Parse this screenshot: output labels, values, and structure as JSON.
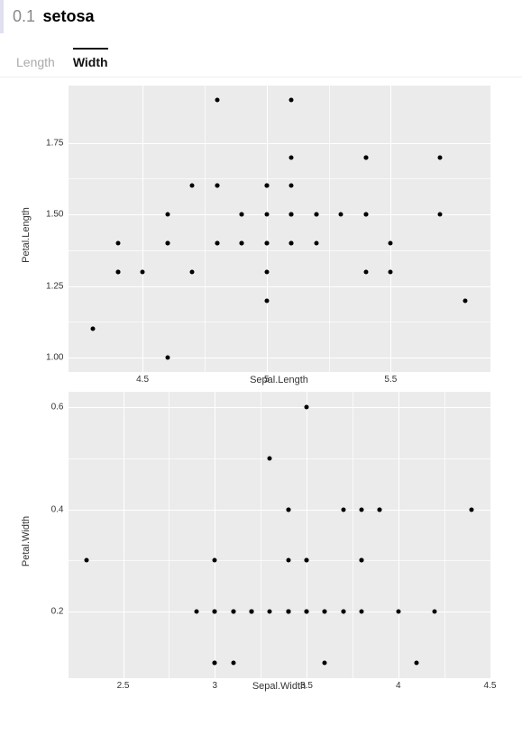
{
  "header": {
    "num": "0.1",
    "title": "setosa"
  },
  "tabs": [
    {
      "id": "length",
      "label": "Length",
      "active": false
    },
    {
      "id": "width",
      "label": "Width",
      "active": true
    }
  ],
  "chart_data": [
    {
      "type": "scatter",
      "xlabel": "Sepal.Length",
      "ylabel": "Petal.Length",
      "xlim": [
        4.2,
        5.9
      ],
      "ylim": [
        0.95,
        1.95
      ],
      "xticks": [
        4.5,
        5.0,
        5.5
      ],
      "yticks": [
        1.0,
        1.25,
        1.5,
        1.75
      ],
      "points": [
        {
          "x": 5.1,
          "y": 1.4
        },
        {
          "x": 4.9,
          "y": 1.4
        },
        {
          "x": 4.7,
          "y": 1.3
        },
        {
          "x": 4.6,
          "y": 1.5
        },
        {
          "x": 5.0,
          "y": 1.4
        },
        {
          "x": 5.4,
          "y": 1.7
        },
        {
          "x": 4.6,
          "y": 1.4
        },
        {
          "x": 5.0,
          "y": 1.5
        },
        {
          "x": 4.4,
          "y": 1.4
        },
        {
          "x": 4.9,
          "y": 1.5
        },
        {
          "x": 5.4,
          "y": 1.5
        },
        {
          "x": 4.8,
          "y": 1.6
        },
        {
          "x": 4.8,
          "y": 1.4
        },
        {
          "x": 4.3,
          "y": 1.1
        },
        {
          "x": 5.8,
          "y": 1.2
        },
        {
          "x": 5.7,
          "y": 1.5
        },
        {
          "x": 5.4,
          "y": 1.3
        },
        {
          "x": 5.1,
          "y": 1.4
        },
        {
          "x": 5.7,
          "y": 1.7
        },
        {
          "x": 5.1,
          "y": 1.5
        },
        {
          "x": 5.4,
          "y": 1.7
        },
        {
          "x": 5.1,
          "y": 1.5
        },
        {
          "x": 4.6,
          "y": 1.0
        },
        {
          "x": 5.1,
          "y": 1.7
        },
        {
          "x": 4.8,
          "y": 1.9
        },
        {
          "x": 5.0,
          "y": 1.6
        },
        {
          "x": 5.0,
          "y": 1.6
        },
        {
          "x": 5.2,
          "y": 1.5
        },
        {
          "x": 5.2,
          "y": 1.4
        },
        {
          "x": 4.7,
          "y": 1.6
        },
        {
          "x": 4.8,
          "y": 1.6
        },
        {
          "x": 5.4,
          "y": 1.5
        },
        {
          "x": 5.2,
          "y": 1.5
        },
        {
          "x": 5.5,
          "y": 1.4
        },
        {
          "x": 4.9,
          "y": 1.5
        },
        {
          "x": 5.0,
          "y": 1.2
        },
        {
          "x": 5.5,
          "y": 1.3
        },
        {
          "x": 4.9,
          "y": 1.4
        },
        {
          "x": 4.4,
          "y": 1.3
        },
        {
          "x": 5.1,
          "y": 1.5
        },
        {
          "x": 5.0,
          "y": 1.3
        },
        {
          "x": 4.5,
          "y": 1.3
        },
        {
          "x": 4.4,
          "y": 1.3
        },
        {
          "x": 5.0,
          "y": 1.6
        },
        {
          "x": 5.1,
          "y": 1.9
        },
        {
          "x": 4.8,
          "y": 1.4
        },
        {
          "x": 5.1,
          "y": 1.6
        },
        {
          "x": 4.6,
          "y": 1.4
        },
        {
          "x": 5.3,
          "y": 1.5
        },
        {
          "x": 5.0,
          "y": 1.4
        }
      ]
    },
    {
      "type": "scatter",
      "xlabel": "Sepal.Width",
      "ylabel": "Petal.Width",
      "xlim": [
        2.2,
        4.5
      ],
      "ylim": [
        0.07,
        0.63
      ],
      "xticks": [
        2.5,
        3.0,
        3.5,
        4.0,
        4.5
      ],
      "yticks": [
        0.2,
        0.4,
        0.6
      ],
      "points": [
        {
          "x": 3.5,
          "y": 0.2
        },
        {
          "x": 3.0,
          "y": 0.2
        },
        {
          "x": 3.2,
          "y": 0.2
        },
        {
          "x": 3.1,
          "y": 0.2
        },
        {
          "x": 3.6,
          "y": 0.2
        },
        {
          "x": 3.9,
          "y": 0.4
        },
        {
          "x": 3.4,
          "y": 0.3
        },
        {
          "x": 3.4,
          "y": 0.2
        },
        {
          "x": 2.9,
          "y": 0.2
        },
        {
          "x": 3.1,
          "y": 0.1
        },
        {
          "x": 3.7,
          "y": 0.2
        },
        {
          "x": 3.4,
          "y": 0.2
        },
        {
          "x": 3.0,
          "y": 0.1
        },
        {
          "x": 3.0,
          "y": 0.1
        },
        {
          "x": 4.0,
          "y": 0.2
        },
        {
          "x": 4.4,
          "y": 0.4
        },
        {
          "x": 3.9,
          "y": 0.4
        },
        {
          "x": 3.5,
          "y": 0.3
        },
        {
          "x": 3.8,
          "y": 0.3
        },
        {
          "x": 3.8,
          "y": 0.3
        },
        {
          "x": 3.4,
          "y": 0.2
        },
        {
          "x": 3.7,
          "y": 0.4
        },
        {
          "x": 3.6,
          "y": 0.2
        },
        {
          "x": 3.3,
          "y": 0.5
        },
        {
          "x": 3.4,
          "y": 0.2
        },
        {
          "x": 3.0,
          "y": 0.2
        },
        {
          "x": 3.4,
          "y": 0.4
        },
        {
          "x": 3.5,
          "y": 0.2
        },
        {
          "x": 3.4,
          "y": 0.2
        },
        {
          "x": 3.2,
          "y": 0.2
        },
        {
          "x": 3.1,
          "y": 0.2
        },
        {
          "x": 3.4,
          "y": 0.4
        },
        {
          "x": 4.1,
          "y": 0.1
        },
        {
          "x": 4.2,
          "y": 0.2
        },
        {
          "x": 3.1,
          "y": 0.2
        },
        {
          "x": 3.2,
          "y": 0.2
        },
        {
          "x": 3.5,
          "y": 0.2
        },
        {
          "x": 3.6,
          "y": 0.1
        },
        {
          "x": 3.0,
          "y": 0.2
        },
        {
          "x": 3.4,
          "y": 0.2
        },
        {
          "x": 3.5,
          "y": 0.3
        },
        {
          "x": 2.3,
          "y": 0.3
        },
        {
          "x": 3.2,
          "y": 0.2
        },
        {
          "x": 3.5,
          "y": 0.6
        },
        {
          "x": 3.8,
          "y": 0.4
        },
        {
          "x": 3.0,
          "y": 0.3
        },
        {
          "x": 3.8,
          "y": 0.2
        },
        {
          "x": 3.2,
          "y": 0.2
        },
        {
          "x": 3.7,
          "y": 0.2
        },
        {
          "x": 3.3,
          "y": 0.2
        }
      ]
    }
  ]
}
